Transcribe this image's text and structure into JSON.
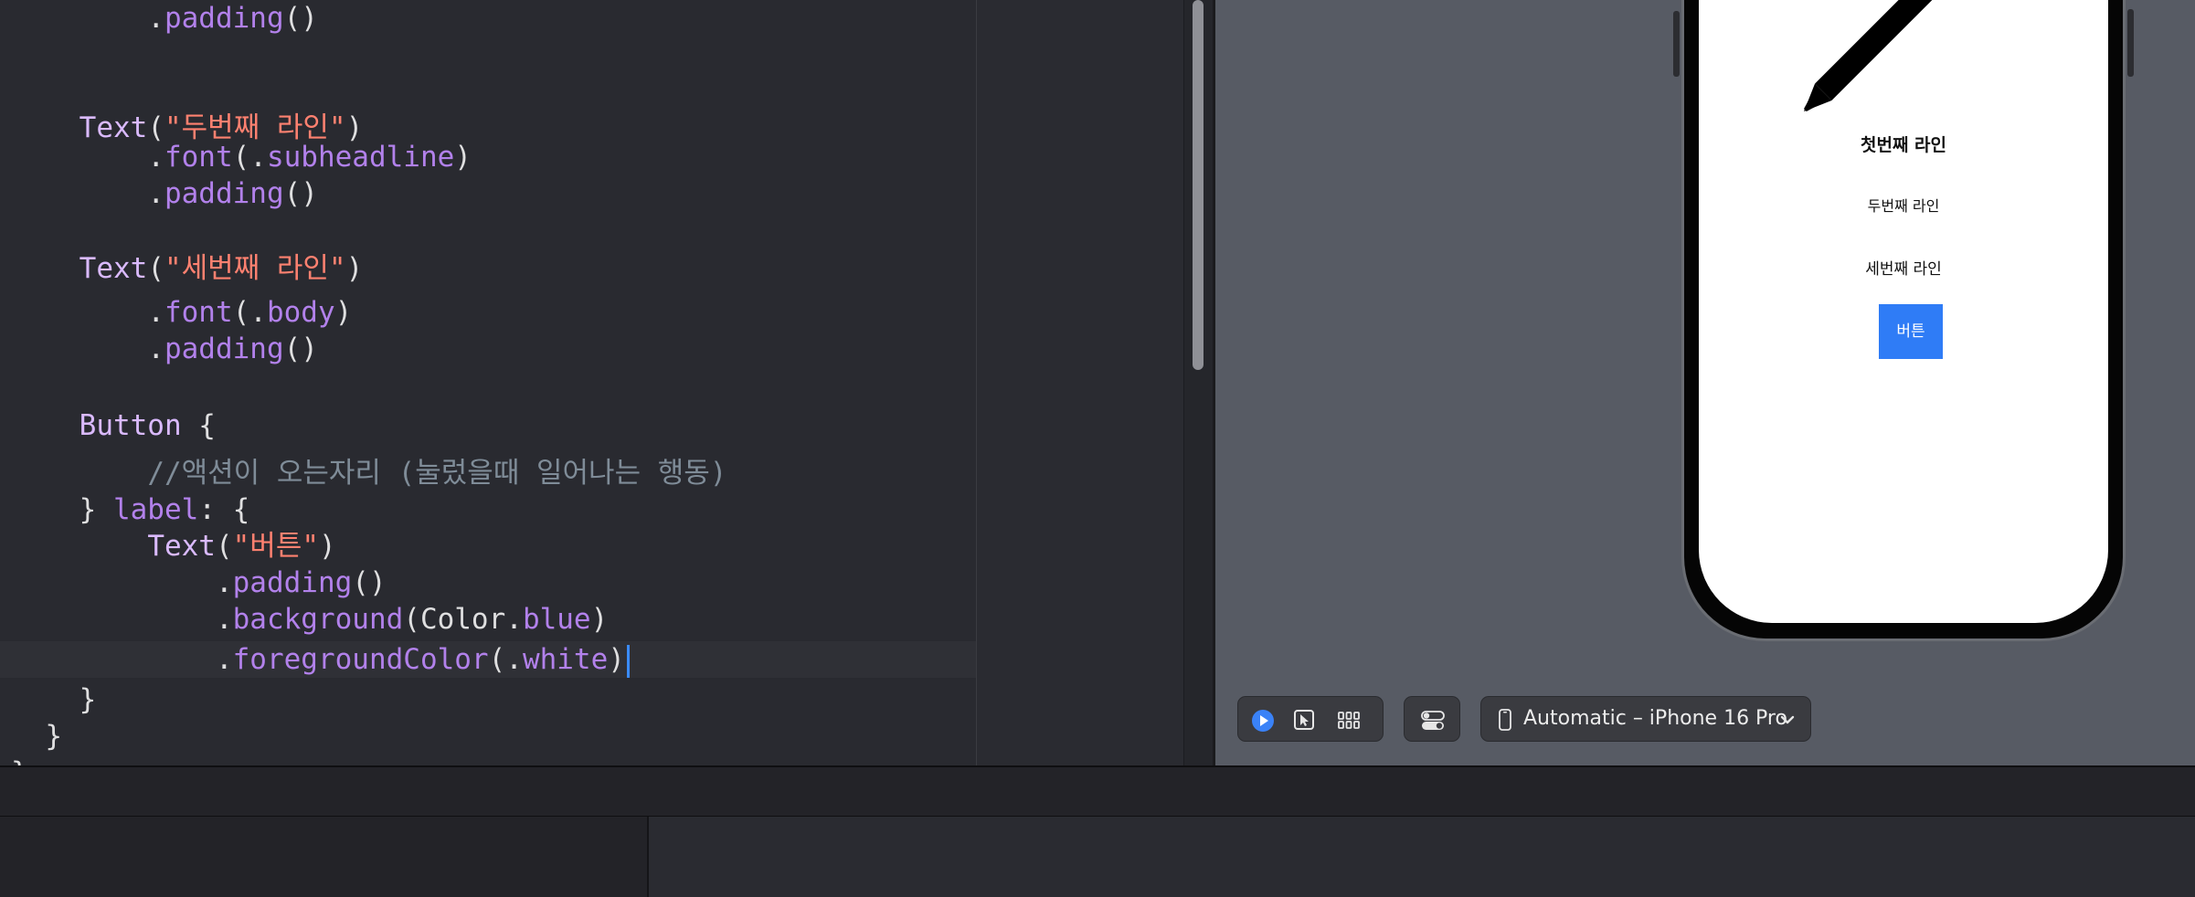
{
  "editor": {
    "lines": [
      [
        {
          "t": "        ",
          "c": "plain"
        },
        {
          "t": ".",
          "c": "plain"
        },
        {
          "t": "padding",
          "c": "member"
        },
        {
          "t": "()",
          "c": "plain"
        }
      ],
      [],
      [
        {
          "t": "    ",
          "c": "plain"
        },
        {
          "t": "Text",
          "c": "type"
        },
        {
          "t": "(",
          "c": "plain"
        },
        {
          "t": "\"두번째 라인\"",
          "c": "str"
        },
        {
          "t": ")",
          "c": "plain"
        }
      ],
      [
        {
          "t": "        ",
          "c": "plain"
        },
        {
          "t": ".",
          "c": "plain"
        },
        {
          "t": "font",
          "c": "member"
        },
        {
          "t": "(.",
          "c": "plain"
        },
        {
          "t": "subheadline",
          "c": "member"
        },
        {
          "t": ")",
          "c": "plain"
        }
      ],
      [
        {
          "t": "        ",
          "c": "plain"
        },
        {
          "t": ".",
          "c": "plain"
        },
        {
          "t": "padding",
          "c": "member"
        },
        {
          "t": "()",
          "c": "plain"
        }
      ],
      [],
      [
        {
          "t": "    ",
          "c": "plain"
        },
        {
          "t": "Text",
          "c": "type"
        },
        {
          "t": "(",
          "c": "plain"
        },
        {
          "t": "\"세번째 라인\"",
          "c": "str"
        },
        {
          "t": ")",
          "c": "plain"
        }
      ],
      [
        {
          "t": "        ",
          "c": "plain"
        },
        {
          "t": ".",
          "c": "plain"
        },
        {
          "t": "font",
          "c": "member"
        },
        {
          "t": "(.",
          "c": "plain"
        },
        {
          "t": "body",
          "c": "member"
        },
        {
          "t": ")",
          "c": "plain"
        }
      ],
      [
        {
          "t": "        ",
          "c": "plain"
        },
        {
          "t": ".",
          "c": "plain"
        },
        {
          "t": "padding",
          "c": "member"
        },
        {
          "t": "()",
          "c": "plain"
        }
      ],
      [],
      [
        {
          "t": "    ",
          "c": "plain"
        },
        {
          "t": "Button",
          "c": "type"
        },
        {
          "t": " {",
          "c": "plain"
        }
      ],
      [
        {
          "t": "        ",
          "c": "plain"
        },
        {
          "t": "//액션이 오는자리 (눌렀을때 일어나는 행동)",
          "c": "cmt"
        }
      ],
      [
        {
          "t": "    ",
          "c": "plain"
        },
        {
          "t": "} ",
          "c": "plain"
        },
        {
          "t": "label",
          "c": "member"
        },
        {
          "t": ": {",
          "c": "plain"
        }
      ],
      [
        {
          "t": "        ",
          "c": "plain"
        },
        {
          "t": "Text",
          "c": "type"
        },
        {
          "t": "(",
          "c": "plain"
        },
        {
          "t": "\"버튼\"",
          "c": "str"
        },
        {
          "t": ")",
          "c": "plain"
        }
      ],
      [
        {
          "t": "            ",
          "c": "plain"
        },
        {
          "t": ".",
          "c": "plain"
        },
        {
          "t": "padding",
          "c": "member"
        },
        {
          "t": "()",
          "c": "plain"
        }
      ],
      [
        {
          "t": "            ",
          "c": "plain"
        },
        {
          "t": ".",
          "c": "plain"
        },
        {
          "t": "background",
          "c": "member"
        },
        {
          "t": "(Color.",
          "c": "plain"
        },
        {
          "t": "blue",
          "c": "member"
        },
        {
          "t": ")",
          "c": "plain"
        }
      ],
      [
        {
          "t": "            ",
          "c": "plain"
        },
        {
          "t": ".",
          "c": "plain"
        },
        {
          "t": "foregroundColor",
          "c": "member"
        },
        {
          "t": "(.",
          "c": "plain"
        },
        {
          "t": "white",
          "c": "member"
        },
        {
          "t": ")",
          "c": "plain"
        }
      ],
      [
        {
          "t": "    ",
          "c": "plain"
        },
        {
          "t": "}",
          "c": "plain"
        }
      ],
      [
        {
          "t": "  ",
          "c": "plain"
        },
        {
          "t": "}",
          "c": "plain"
        }
      ],
      [
        {
          "t": "}",
          "c": "plain"
        }
      ]
    ],
    "current_line_index": 16,
    "colors": {
      "background": "#292a30",
      "plain": "#dfdfe0",
      "type": "#dabaff",
      "string": "#ff8170",
      "member": "#b281eb",
      "comment": "#7f8c98",
      "caret": "#3a8bff"
    }
  },
  "preview": {
    "line1": "첫번째 라인",
    "line2": "두번째 라인",
    "line3": "세번째 라인",
    "button_label": "버튼",
    "button_color": "#2f7cf6"
  },
  "toolbar": {
    "live_icon": "play-circle-icon",
    "selectable_icon": "cursor-select-icon",
    "variants_icon": "grid-variants-icon",
    "settings_icon": "device-settings-icon",
    "device_icon": "iphone-icon",
    "device_label": "Automatic – iPhone 16 Pro",
    "chevron_icon": "chevron-down-icon"
  }
}
